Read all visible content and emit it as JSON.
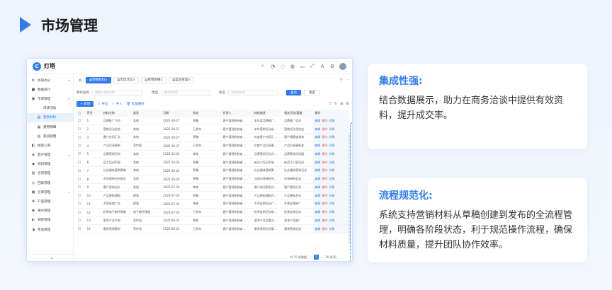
{
  "header": {
    "title": "市场管理"
  },
  "app": {
    "logo_mark": "C",
    "logo_text": "灯塔",
    "sidebar": [
      {
        "label": "协同办公",
        "icon": "⚙",
        "expandable": true,
        "sub": false,
        "active": false
      },
      {
        "label": "数据统计",
        "icon": "■",
        "expandable": false,
        "sub": false,
        "active": false
      },
      {
        "label": "市场管理",
        "icon": "▣",
        "expandable": true,
        "sub": false,
        "active": false
      },
      {
        "label": "市场活动",
        "icon": "",
        "expandable": false,
        "sub": true,
        "active": false
      },
      {
        "label": "营销材料",
        "icon": "▤",
        "expandable": false,
        "sub": true,
        "active": true
      },
      {
        "label": "费用明细",
        "icon": "▦",
        "expandable": false,
        "sub": true,
        "active": false
      },
      {
        "label": "渠道管理",
        "icon": "▥",
        "expandable": false,
        "sub": true,
        "active": false
      },
      {
        "label": "线索公海",
        "icon": "◧",
        "expandable": false,
        "sub": false,
        "active": false
      },
      {
        "label": "客户管理",
        "icon": "◈",
        "expandable": true,
        "sub": false,
        "active": false
      },
      {
        "label": "商机管理",
        "icon": "◆",
        "expandable": false,
        "sub": false,
        "active": false
      },
      {
        "label": "合同管理",
        "icon": "▧",
        "expandable": false,
        "sub": false,
        "active": false
      },
      {
        "label": "回款管理",
        "icon": "◎",
        "expandable": false,
        "sub": false,
        "active": false
      },
      {
        "label": "仓库管理",
        "icon": "▩",
        "expandable": true,
        "sub": false,
        "active": false
      },
      {
        "label": "产品管理",
        "icon": "✚",
        "expandable": false,
        "sub": false,
        "active": false
      },
      {
        "label": "报价管理",
        "icon": "◉",
        "expandable": false,
        "sub": false,
        "active": false
      },
      {
        "label": "销售管理",
        "icon": "◐",
        "expandable": false,
        "sub": false,
        "active": false
      },
      {
        "label": "售后管理",
        "icon": "◑",
        "expandable": false,
        "sub": false,
        "active": false
      }
    ],
    "collapse_label": "«",
    "tabs": [
      {
        "label": "营销材料",
        "active": true
      },
      {
        "label": "市场活动",
        "active": false
      },
      {
        "label": "费用明细",
        "active": false
      },
      {
        "label": "渠道管理",
        "active": false
      }
    ],
    "filters": {
      "name_label": "材料名称",
      "name_placeholder": "请输入材料名称",
      "type_label": "类型",
      "type_placeholder": "请选择类型",
      "status_label": "状态",
      "status_placeholder": "请选择状态",
      "query": "查询",
      "reset": "重置"
    },
    "actions": {
      "new": "+ 新增",
      "export": "导出",
      "import": "导入",
      "batch_delete": "批量删除"
    },
    "table": {
      "headers": [
        "",
        "序号",
        "材料名称",
        "类型",
        "日期",
        "状态",
        "负责人",
        "材料描述",
        "相关活动/渠道",
        "操作"
      ],
      "rows": [
        [
          "1",
          "品牌推广介绍",
          "其他",
          "2025-10-27",
          "草稿",
          "客户管理系统者…",
          "本年度品牌推广…",
          "品牌推广会议"
        ],
        [
          "2",
          "营销活动总结",
          "其他",
          "2025-10-27",
          "已发布",
          "客户管理系统者…",
          "本年营销活动总…",
          "营销活动总结会"
        ],
        [
          "3",
          "客户应用汇总",
          "其他",
          "2025-10-27",
          "草稿",
          "客户管理系统者…",
          "年度客户应用汇…",
          "客户满意度调查"
        ],
        [
          "4",
          "产品目录更新",
          "宣传册",
          "2025-10-27",
          "已发布",
          "客户管理系统者…",
          "年度产品目录更…",
          "产品目录更新会"
        ],
        [
          "5",
          "品牌营销活动",
          "其他",
          "2025-10-20",
          "审核",
          "客户管理系统者…",
          "品牌营销活动合…",
          "品牌营销活动展"
        ],
        [
          "6",
          "员工培训手册",
          "其他",
          "2025-10-20",
          "草稿",
          "客户管理系统者…",
          "新员工培训手册",
          "新员工入职培训"
        ],
        [
          "7",
          "社交媒体营销策略",
          "其他",
          "2025-10-20",
          "草稿",
          "客户管理系统者…",
          "社交媒体营销策…",
          "社交媒体营销活动"
        ],
        [
          "8",
          "市场调研分析报告",
          "其他",
          "2025-10-20",
          "草稿",
          "客户管理系统者…",
          "当前市场调研分…",
          "市场调研会议"
        ],
        [
          "9",
          "客户案例分析",
          "其他",
          "2025-07-20",
          "审核",
          "客户管理系统者…",
          "客户成功案例分…",
          "客户案例分享"
        ],
        [
          "10",
          "产品更新通报",
          "视频",
          "2025-07-20",
          "草稿",
          "客户管理系统者…",
          "产品更新通报内…",
          "产品更新发布"
        ],
        [
          "11",
          "冬季促销广告",
          "视频",
          "2025-07-20",
          "审核",
          "客户管理系统者…",
          "冬季促销活动广…",
          "冬季促销推广"
        ],
        [
          "12",
          "秋季电子邮件模版",
          "电子邮件模版",
          "2025-07-20",
          "已发布",
          "客户管理系统者…",
          "秋季促销活动电…",
          "秋季促销活动"
        ],
        [
          "13",
          "夏季产品手册",
          "宣传册",
          "2025-06-22",
          "审核",
          "客户管理系统者…",
          "夏季产品优惠活…",
          "夏季产品推广"
        ],
        [
          "14",
          "春季营销策划",
          "宣传册",
          "2025-06-20",
          "已发布",
          "客户管理系统者…",
          "春季营销活动策…",
          "春季营销活动"
        ]
      ],
      "ops": [
        "编辑",
        "删除",
        "详情"
      ]
    },
    "pager": {
      "total": "共 19 条数据",
      "current": "1",
      "size": "20 条/页"
    }
  },
  "cards": [
    {
      "title": "集成性强:",
      "text": "结合数据展示，助力在商务洽谈中提供有效资料，提升成交率。"
    },
    {
      "title": "流程规范化:",
      "text": "系统支持营销材料从草稿创建到发布的全流程管理，明确各阶段状态，利于规范操作流程，确保材料质量，提升团队协作效率。"
    }
  ],
  "colors": {
    "accent": "#2f7cf0",
    "danger": "#ee5555"
  }
}
